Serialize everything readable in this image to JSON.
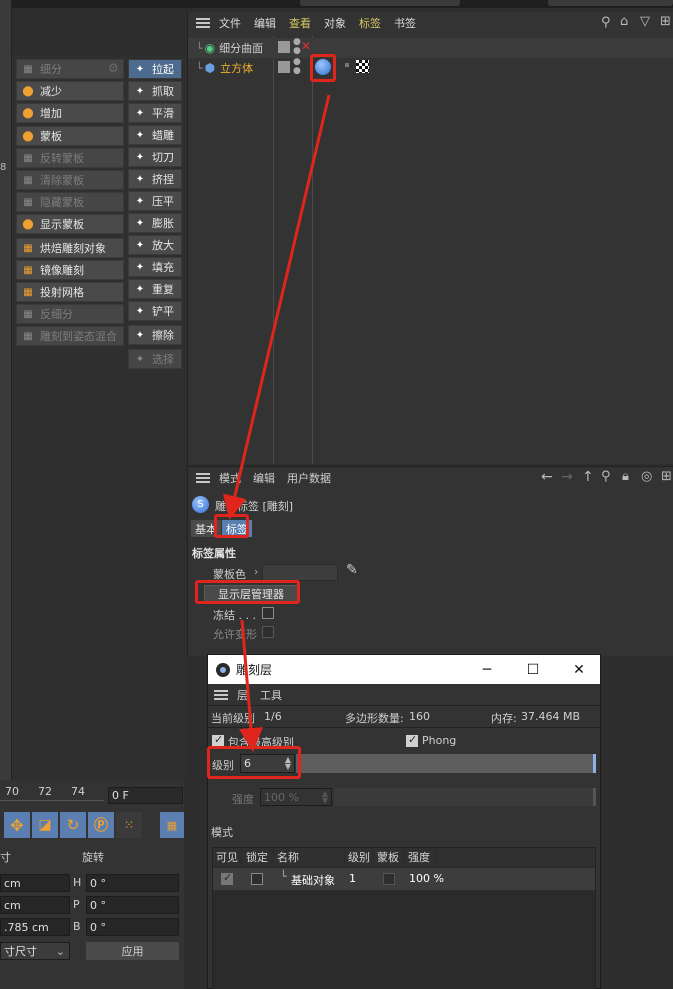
{
  "object_manager": {
    "menu": [
      "文件",
      "编辑",
      "查看",
      "对象",
      "标签",
      "书签"
    ],
    "objects": [
      {
        "name": "细分曲面",
        "color": "#d8d8d8"
      },
      {
        "name": "立方体",
        "color": "#f0b030"
      }
    ]
  },
  "sculpt_tools": {
    "left_column": [
      {
        "label": "细分",
        "disabled": true
      },
      {
        "label": "减少",
        "disabled": false
      },
      {
        "label": "增加",
        "disabled": false
      },
      {
        "label": "蒙板",
        "disabled": false
      },
      {
        "label": "反转蒙板",
        "disabled": true
      },
      {
        "label": "清除蒙板",
        "disabled": true
      },
      {
        "label": "隐藏蒙板",
        "disabled": true
      },
      {
        "label": "显示蒙板",
        "disabled": false
      },
      {
        "label": "烘焙雕刻对象",
        "disabled": false
      },
      {
        "label": "镜像雕刻",
        "disabled": false
      },
      {
        "label": "投射网格",
        "disabled": false
      },
      {
        "label": "反细分",
        "disabled": true
      },
      {
        "label": "雕刻到姿态混合",
        "disabled": true
      }
    ],
    "right_column": [
      {
        "label": "拉起",
        "selected": true
      },
      {
        "label": "抓取"
      },
      {
        "label": "平滑"
      },
      {
        "label": "蜡雕"
      },
      {
        "label": "切刀"
      },
      {
        "label": "挤捏"
      },
      {
        "label": "压平"
      },
      {
        "label": "膨胀"
      },
      {
        "label": "放大"
      },
      {
        "label": "填充"
      },
      {
        "label": "重复"
      },
      {
        "label": "铲平"
      },
      {
        "label": "擦除"
      },
      {
        "label": "选择",
        "disabled": true
      }
    ]
  },
  "attribute_manager": {
    "menu": [
      "模式",
      "编辑",
      "用户数据"
    ],
    "title": "雕刻标签 [雕刻]",
    "tabs": [
      "基本",
      "标签"
    ],
    "section": "标签属性",
    "mask_color_label": "蒙板色",
    "show_layer_manager": "显示层管理器",
    "freeze_label": "冻结 . . .",
    "allow_deform_label": "允许变形"
  },
  "timeline": {
    "ticks": [
      "70",
      "72",
      "74"
    ],
    "frame": "0 F"
  },
  "coords": {
    "size_header": "寸",
    "rotation_header": "旋转",
    "rows": [
      {
        "left": "cm",
        "axis": "H",
        "value": "0 °"
      },
      {
        "left": "cm",
        "axis": "P",
        "value": "0 °"
      },
      {
        "left": ".785 cm",
        "axis": "B",
        "value": "0 °"
      }
    ],
    "mode": "寸尺寸",
    "apply": "应用"
  },
  "dialog": {
    "title": "雕刻层",
    "menu": [
      "层",
      "工具"
    ],
    "current_level_label": "当前级别",
    "current_level_value": "1/6",
    "poly_count_label": "多边形数量:",
    "poly_count_value": "160",
    "memory_label": "内存:",
    "memory_value": "37.464 MB",
    "include_highest": "包含最高级别",
    "phong": "Phong",
    "level_label": "级别",
    "level_value": "6",
    "strength_label": "强度",
    "strength_value": "100 %",
    "mode_label": "模式",
    "table_headers": [
      "可见",
      "锁定",
      "名称",
      "级别",
      "蒙板",
      "强度"
    ],
    "rows": [
      {
        "name": "基础对象",
        "level": "1",
        "strength": "100 %"
      }
    ]
  },
  "colors": {
    "highlight": "#e0251c",
    "accent": "#5a7fae",
    "tag_yellow": "#f0b030"
  }
}
